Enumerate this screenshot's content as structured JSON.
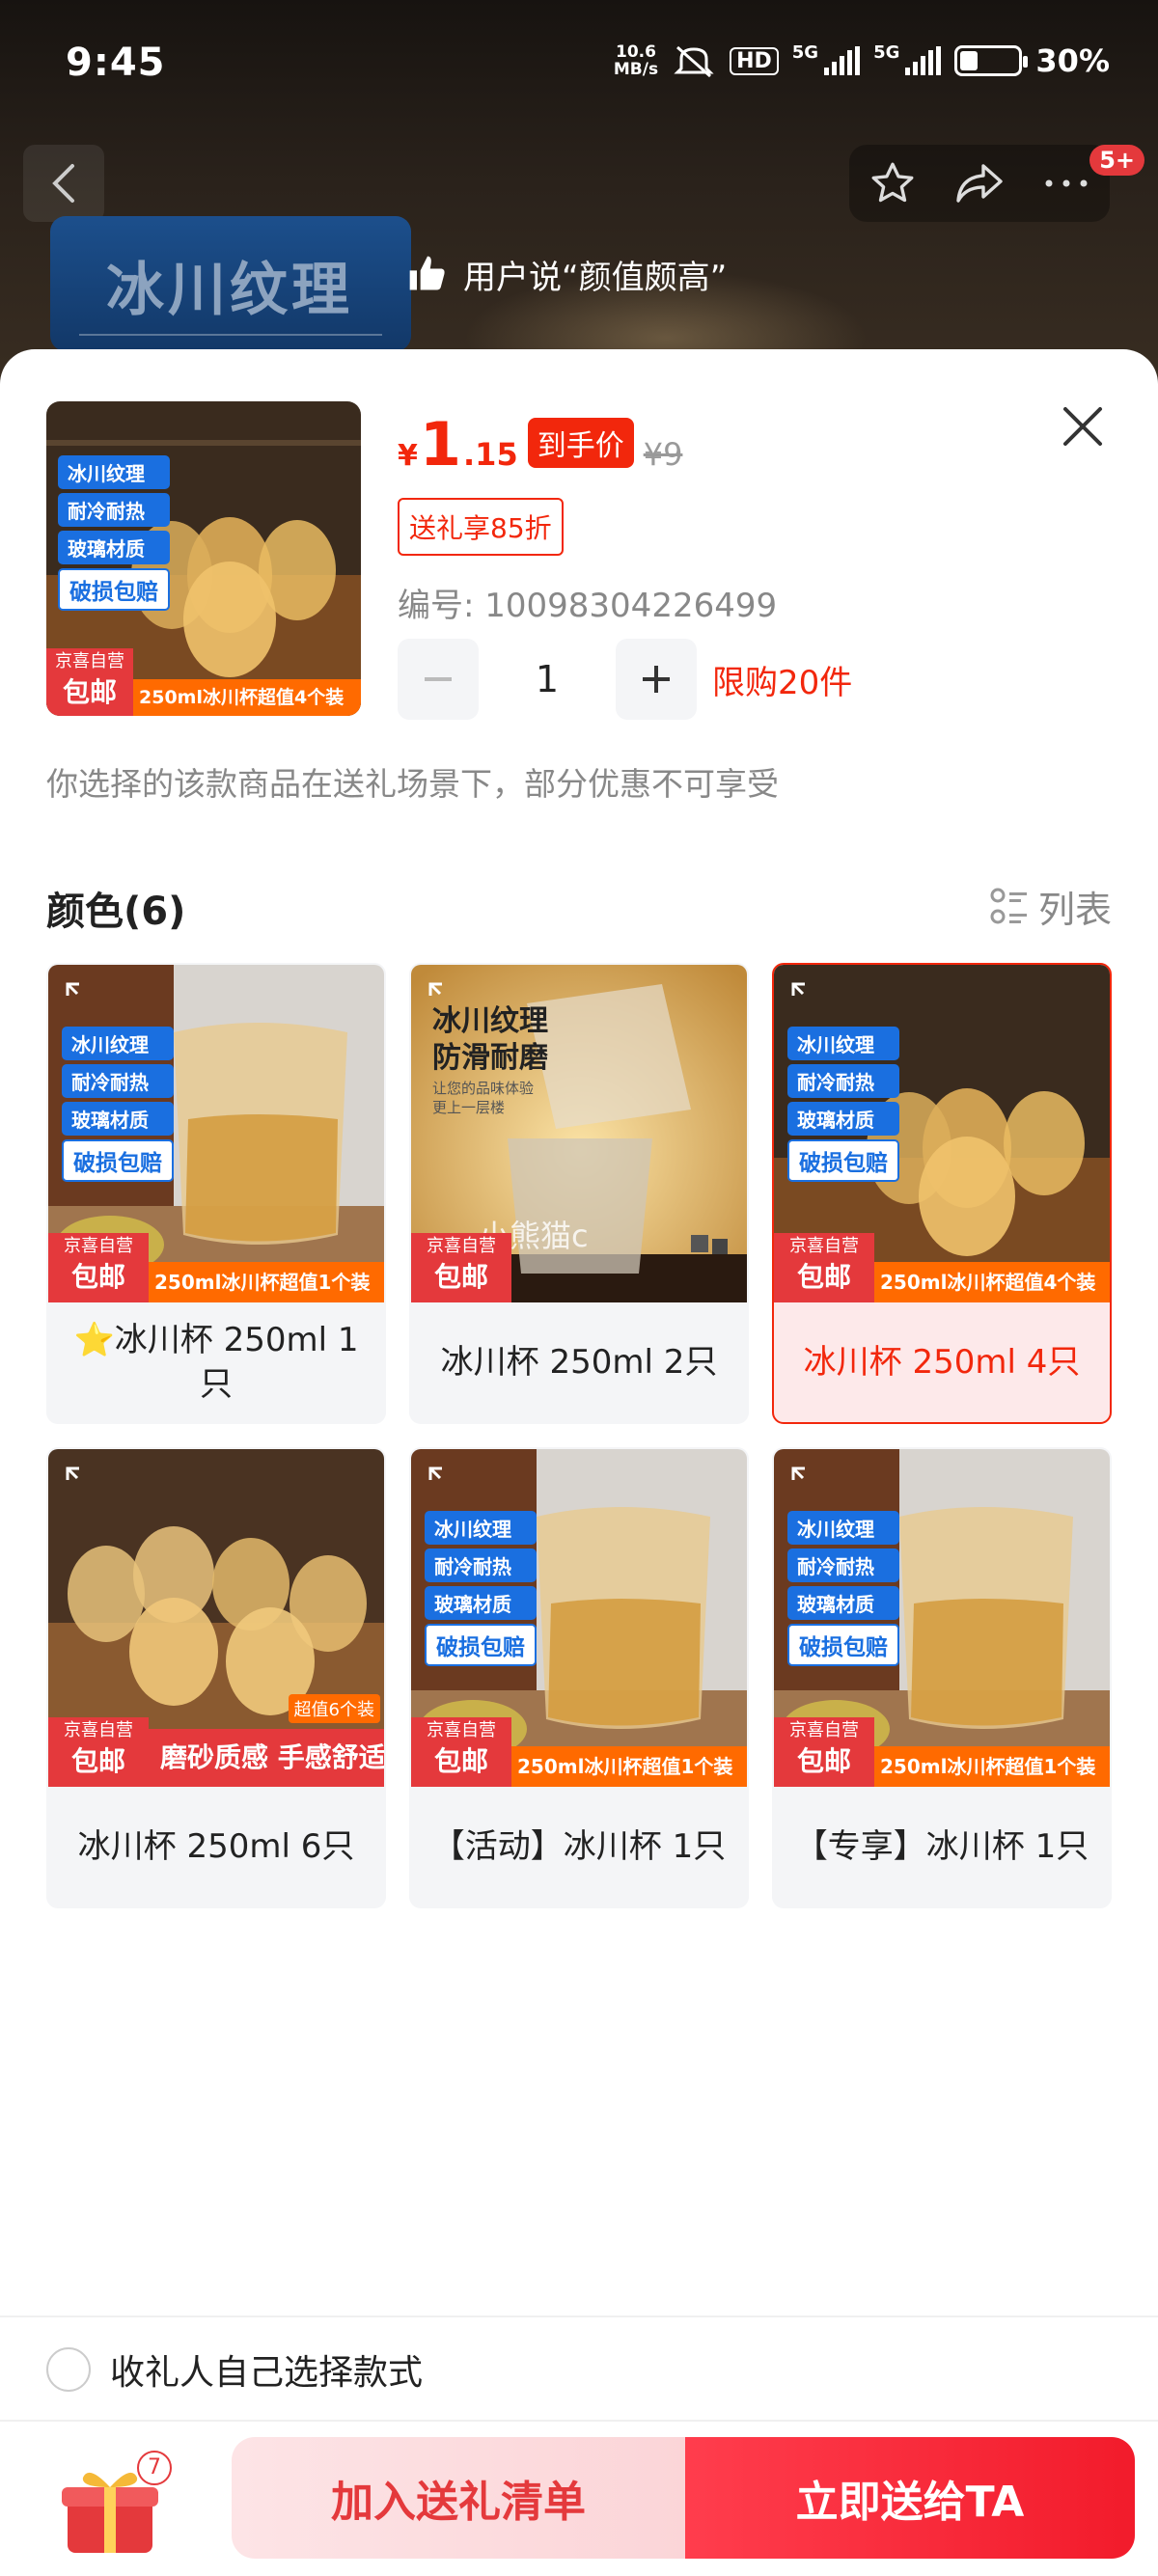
{
  "status": {
    "time": "9:45",
    "net_speed_value": "10.6",
    "net_speed_unit": "MB/s",
    "hd_label": "HD",
    "network1": "5G",
    "network2": "5G",
    "battery_percent": 30,
    "battery_label": "30%"
  },
  "nav": {
    "badge": "5+"
  },
  "background": {
    "feature_tag": "冰川纹理",
    "review_banner": "用户说“颜值颇高”"
  },
  "product": {
    "thumb_chips": [
      "冰川纹理",
      "耐冷耐热",
      "玻璃材质"
    ],
    "thumb_chip_white": "破损包赔",
    "thumb_badge_small": "京喜自营",
    "thumb_badge_big": "包邮",
    "thumb_strip": "250ml冰川杯超值4个装",
    "price_currency": "¥",
    "price_integer": "1",
    "price_decimal": ".15",
    "price_tag": "到手价",
    "original_price": "¥9",
    "coupon": "送礼享85折",
    "sku_number": "编号: 10098304226499",
    "quantity": "1",
    "limit": "限购20件",
    "gift_note": "你选择的该款商品在送礼场景下，部分优惠不可享受"
  },
  "colors": {
    "title": "颜色(6)",
    "list_toggle": "列表",
    "options": [
      {
        "label": "⭐冰川杯 250ml 1只",
        "selected": false,
        "strip": "250ml冰川杯超值1个装"
      },
      {
        "label": "冰川杯 250ml 2只",
        "selected": false,
        "promo_title_1": "冰川纹理",
        "promo_title_2": "防滑耐磨",
        "promo_sub_1": "让您的品味体验",
        "promo_sub_2": "更上一层楼",
        "watermark": "小熊猫c"
      },
      {
        "label": "冰川杯 250ml 4只",
        "selected": true,
        "strip": "250ml冰川杯超值4个装"
      },
      {
        "label": "冰川杯 250ml 6只",
        "selected": false,
        "strip": "磨砂质感  手感舒适",
        "mini_tag": "超值6个装"
      },
      {
        "label": "【活动】冰川杯 1只",
        "selected": false,
        "strip": "250ml冰川杯超值1个装"
      },
      {
        "label": "【专享】冰川杯 1只",
        "selected": false,
        "strip": "250ml冰川杯超值1个装"
      }
    ],
    "chips": [
      "冰川纹理",
      "耐冷耐热",
      "玻璃材质"
    ],
    "chip_white": "破损包赔",
    "badge_small": "京喜自营",
    "badge_big": "包邮"
  },
  "recipient_option": "收礼人自己选择款式",
  "bottom": {
    "gift_count": "7",
    "add_label": "加入送礼清单",
    "send_label": "立即送给TA"
  }
}
